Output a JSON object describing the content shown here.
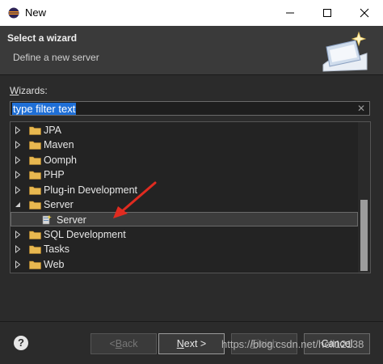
{
  "window": {
    "title": "New"
  },
  "header": {
    "title": "Select a wizard",
    "description": "Define a new server"
  },
  "wizards": {
    "label_underlined": "W",
    "label_rest": "izards:",
    "filter_placeholder": "type filter text"
  },
  "tree": {
    "items": [
      {
        "label": "JPA",
        "expanded": false
      },
      {
        "label": "Maven",
        "expanded": false
      },
      {
        "label": "Oomph",
        "expanded": false
      },
      {
        "label": "PHP",
        "expanded": false
      },
      {
        "label": "Plug-in Development",
        "expanded": false
      },
      {
        "label": "Server",
        "expanded": true
      },
      {
        "label": "Server",
        "child": true,
        "selected": true
      },
      {
        "label": "SQL Development",
        "expanded": false
      },
      {
        "label": "Tasks",
        "expanded": false
      },
      {
        "label": "Web",
        "expanded": false
      }
    ]
  },
  "buttons": {
    "help": "?",
    "back_mnemonic": "B",
    "back_prefix": "< ",
    "back_rest": "ack",
    "next_mnemonic": "N",
    "next_rest": "ext >",
    "finish_mnemonic": "F",
    "finish_rest": "inish",
    "cancel": "Cancel"
  },
  "watermark": "https://blog.csdn.net/hell12138",
  "colors": {
    "accent_arrow": "#e02b20",
    "selection": "#1f6fd6",
    "folder": "#e8b850"
  }
}
